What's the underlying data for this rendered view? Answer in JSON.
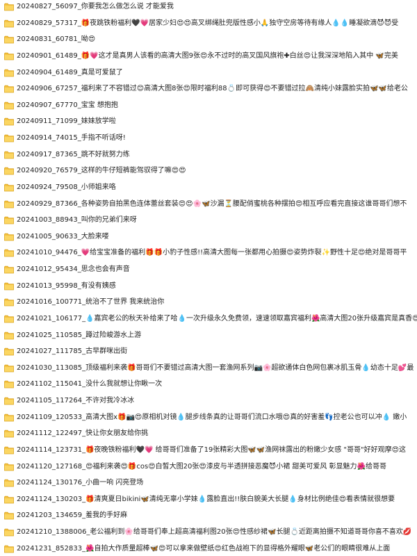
{
  "folders": [
    {
      "name": "20240827_56097_你要我怎么做怎么说 才能爱我"
    },
    {
      "name": "20240829_57317_🎁夜跳铁粉福利🖤💗居家少妇😍😍高叉绑绳肚兜版性感小🙏独守空房等待有缘人💧💧睡凝欲滴😈😈受"
    },
    {
      "name": "20240831_60781_呦😍"
    },
    {
      "name": "20240901_61489_🎁💗这才是真男人该看的高清大图9张😍永不过时的高叉国风旗袍✚白丝😍让我深深地陷入其中 🦋完美"
    },
    {
      "name": "20240904_61489_真是可爱鼠了"
    },
    {
      "name": "20240906_67257_福利来了不容错过😊高清大图8张😍限时福利88💍即可获得😍不要错过拉🙈清纯小妹露脸实拍🦋🦋给老公"
    },
    {
      "name": "20240907_67770_宝宝  想抱抱"
    },
    {
      "name": "20240911_71099_妹妹放学啦"
    },
    {
      "name": "20240914_74015_手指不听话呀!"
    },
    {
      "name": "20240917_87365_跳不好就努力练"
    },
    {
      "name": "20240920_76579_这样的牛仔短裤能驾驭得了嘛😍😍"
    },
    {
      "name": "20240924_79508_小师姐来咯"
    },
    {
      "name": "20240929_87366_各种姿势自拍黑色连体蕾丝套装😍😍🌸🦋沙漏⏳腰配俏蜜桃各种摆拍😍相互呼应看完直接这谁哥哥们想不"
    },
    {
      "name": "20241003_88943_叫你的兄弟们来呀"
    },
    {
      "name": "20241005_90633_大脸来喽"
    },
    {
      "name": "20241010_94476_💗给宝宝准备的福利🎁🎁小豹子性感!!高清大图每一张都用心拍摄😍姿势炸裂✨野性十足😍绝对是哥哥平"
    },
    {
      "name": "20241012_95434_思念也会有声音"
    },
    {
      "name": "20241013_95998_有没有姨感"
    },
    {
      "name": "20241016_100771_统治不了世界 我来统治你"
    },
    {
      "name": "20241021_106177_💧嘉宾老公的秋天补给来了哈💧一次升级永久免费领，速速领取嘉宾福利🌺高清大图20张升级嘉宾是真香😍"
    },
    {
      "name": "20241025_110585_蹲过险峻游水上游"
    },
    {
      "name": "20241027_111785_古早群咪出街"
    },
    {
      "name": "20241030_113085_顶级福利来袭🎁哥哥们不要错过高清大图一套渔网系列📷🌸超欲通体白色网包裹冰肌玉骨💧幼态十足💕最"
    },
    {
      "name": "20241102_115041_没什么我就想让你瞅一次"
    },
    {
      "name": "20241105_117264_不许对我冷冰冰"
    },
    {
      "name": "20241109_120533_高清大图x🎁📷😍原相机对镜💧腿步线条真的让哥哥们流口水哦😍真的好害羞👣控老公也可以冲💧 嫩小"
    },
    {
      "name": "20241112_122497_快让你女朋友给你挑"
    },
    {
      "name": "20241114_123731_🎁夜晚铁粉福利🖤💗 给哥哥们准备了19张精彩大图🦋🦋渔网袜露出的粉嫩少女感 \"哥哥\"好好观摩😍这"
    },
    {
      "name": "20241120_127168_😍福利来袭😍🎁cos😍白皙大图20张😍漆皮与半透拼接恶魔😈小裙 甜美可爱风 彰显魅力🌺给哥哥"
    },
    {
      "name": "20241124_130176_小曲一响  闪亮登场"
    },
    {
      "name": "20241124_130203_🎁清爽夏日bikini🦋清纯无辜小学妹💧露脸直出!!肤白貌美大长腿💧身材比例绝佳😍看表情就很想要"
    },
    {
      "name": "20241203_134659_羞我的手好麻"
    },
    {
      "name": "20241210_1388006_老公福利到🌸给哥哥们奉上超高清福利图20张😍性感纱裙🦋长腿💍近距离拍摄不知道哥哥你喜不喜欢💋"
    },
    {
      "name": "20241231_852833_🌺自拍大作质量超棒🦋😍可以拿来做壁纸😍红色战袍下的显得格外耀眼🦋老公们的眼睛很难从上面"
    }
  ]
}
